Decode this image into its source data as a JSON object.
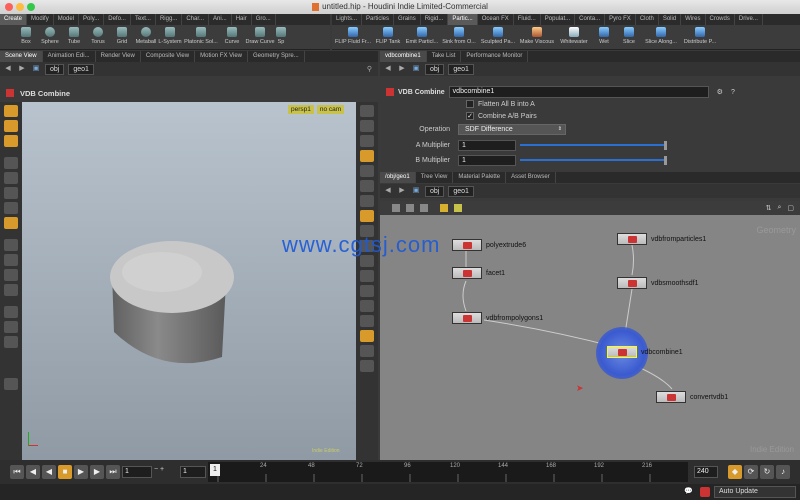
{
  "window": {
    "title": "untitled.hip - Houdini Indie Limited-Commercial"
  },
  "shelf_tabs_left": [
    "Create",
    "Modify",
    "Model",
    "Poly...",
    "Defo...",
    "Text...",
    "Rigg...",
    "Char...",
    "Ani...",
    "Hair",
    "Gro..."
  ],
  "shelf_tabs_right": [
    "Lights...",
    "Particles",
    "Grains",
    "Rigid...",
    "Partic...",
    "Ocean FX",
    "Fluid...",
    "Populat...",
    "Conta...",
    "Pyro FX",
    "Cloth",
    "Solid",
    "Wires",
    "Crowds",
    "Drive..."
  ],
  "shelf_tools_left": [
    "Box",
    "Sphere",
    "Tube",
    "Torus",
    "Grid",
    "Metaball",
    "L-System",
    "Platonic Sol...",
    "Curve",
    "Draw Curve",
    "Sp"
  ],
  "shelf_tools_right": [
    "FLIP Fluid Fr...",
    "FLIP Tank",
    "Emit Particl...",
    "Sink from O...",
    "Sculpted Pa...",
    "Make Viscous",
    "Whitewater",
    "Wet",
    "Slice",
    "Slice Along...",
    "Distribute P..."
  ],
  "left_pane": {
    "tabs": [
      "Scene View",
      "Animation Edi...",
      "Render View",
      "Composite View",
      "Motion FX View",
      "Geometry Spre..."
    ],
    "path": [
      "obj",
      "geo1"
    ],
    "viewport_title": "VDB Combine",
    "camera": "persp1",
    "cam_menu": "no cam",
    "edition_watermark": "Indie Edition"
  },
  "parm_pane": {
    "tabs": [
      "vdbcombine1",
      "Take List",
      "Performance Monitor"
    ],
    "path": [
      "obj",
      "geo1"
    ],
    "node_type": "VDB Combine",
    "node_name": "vdbcombine1",
    "flatten_label": "Flatten All B into A",
    "combine_pairs_label": "Combine A/B Pairs",
    "combine_pairs_checked": true,
    "operation_label": "Operation",
    "operation_value": "SDF Difference",
    "a_mult_label": "A Multiplier",
    "a_mult_value": "1",
    "b_mult_label": "B Multiplier",
    "b_mult_value": "1"
  },
  "network_pane": {
    "tabs": [
      "/obj/geo1",
      "Tree View",
      "Material Palette",
      "Asset Browser"
    ],
    "path": [
      "obj",
      "geo1"
    ],
    "context_label": "Geometry",
    "watermark": "Indie Edition",
    "nodes": [
      "polyextrude6",
      "facet1",
      "vdbfrompolygons1",
      "vdbfromparticles1",
      "vdbsmoothsdf1",
      "vdbcombine1",
      "convertvdb1"
    ]
  },
  "site_watermark": "www.cgtsj.com",
  "timeline": {
    "start": "1",
    "current": "1",
    "end": "240",
    "frame_field": "1",
    "ticks": [
      "1",
      "24",
      "48",
      "72",
      "96",
      "120",
      "144",
      "168",
      "192",
      "216"
    ]
  },
  "status": {
    "auto_update": "Auto Update"
  },
  "colors": {
    "accent": "#d89a2a",
    "selected_node": "#3a6fd8",
    "link_blue": "#1e5bd6"
  }
}
